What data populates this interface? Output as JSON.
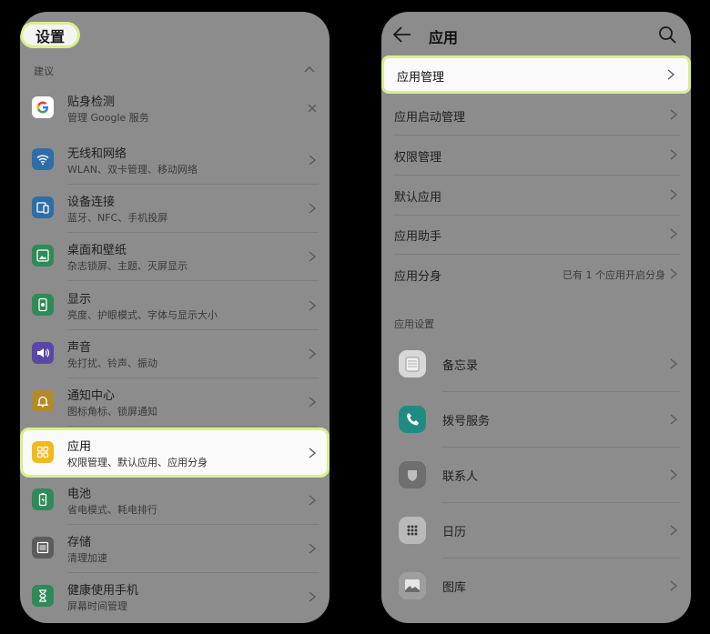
{
  "left": {
    "title": "设置",
    "suggestion_label": "建议",
    "suggestion": {
      "title": "贴身检测",
      "subtitle": "管理 Google 服务"
    },
    "items": [
      {
        "title": "无线和网络",
        "subtitle": "WLAN、双卡管理、移动网络",
        "icon": "wifi-icon",
        "color": "#2e6ea8"
      },
      {
        "title": "设备连接",
        "subtitle": "蓝牙、NFC、手机投屏",
        "icon": "device-connect-icon",
        "color": "#2e6ea8"
      },
      {
        "title": "桌面和壁纸",
        "subtitle": "杂志锁屏、主题、灭屏显示",
        "icon": "wallpaper-icon",
        "color": "#2f8a57"
      },
      {
        "title": "显示",
        "subtitle": "亮度、护眼模式、字体与显示大小",
        "icon": "display-icon",
        "color": "#2f8a57"
      },
      {
        "title": "声音",
        "subtitle": "免打扰、铃声、振动",
        "icon": "sound-icon",
        "color": "#5a46a6"
      },
      {
        "title": "通知中心",
        "subtitle": "图标角标、锁屏通知",
        "icon": "bell-icon",
        "color": "#b28a2a"
      },
      {
        "title": "应用",
        "subtitle": "权限管理、默认应用、应用分身",
        "icon": "apps-grid-icon",
        "color": "#f2b81e"
      },
      {
        "title": "电池",
        "subtitle": "省电模式、耗电排行",
        "icon": "battery-icon",
        "color": "#2f8a57"
      },
      {
        "title": "存储",
        "subtitle": "清理加速",
        "icon": "storage-icon",
        "color": "#5c5c5c"
      },
      {
        "title": "健康使用手机",
        "subtitle": "屏幕时间管理",
        "icon": "hourglass-icon",
        "color": "#2f8a57"
      }
    ]
  },
  "right": {
    "title": "应用",
    "menu": [
      {
        "title": "应用管理",
        "value": ""
      },
      {
        "title": "应用启动管理",
        "value": ""
      },
      {
        "title": "权限管理",
        "value": ""
      },
      {
        "title": "默认应用",
        "value": ""
      },
      {
        "title": "应用助手",
        "value": ""
      },
      {
        "title": "应用分身",
        "value": "已有 1 个应用开启分身"
      }
    ],
    "app_settings_label": "应用设置",
    "apps": [
      {
        "title": "备忘录",
        "icon": "notes-icon"
      },
      {
        "title": "拨号服务",
        "icon": "phone-icon"
      },
      {
        "title": "联系人",
        "icon": "contacts-icon"
      },
      {
        "title": "日历",
        "icon": "calendar-icon"
      },
      {
        "title": "图库",
        "icon": "gallery-icon"
      }
    ]
  }
}
